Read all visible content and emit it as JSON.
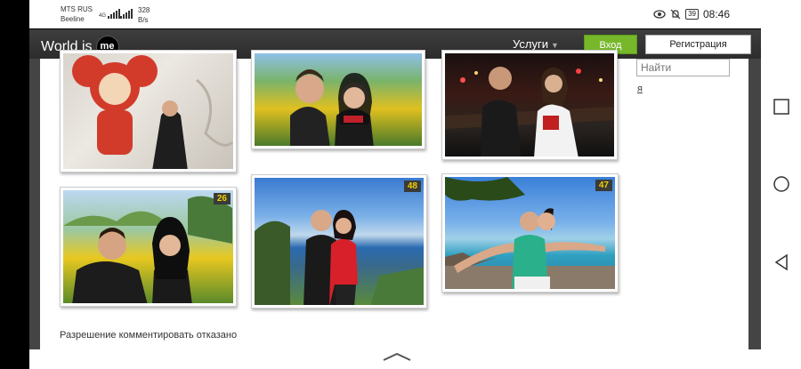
{
  "status_bar": {
    "carrier1": "MTS RUS",
    "carrier2": "Beeline",
    "net_type": "4G",
    "speed_value": "328",
    "speed_unit": "B/s",
    "battery": "39",
    "time": "08:46"
  },
  "header": {
    "logo_text": "World is",
    "logo_badge": "me",
    "services_label": "Услуги",
    "login_label": "Вход",
    "register_label": "Регистрация"
  },
  "sidebar": {
    "search_placeholder": "Найти",
    "link_text": "я"
  },
  "gallery": {
    "photos": [
      {
        "badge": ""
      },
      {
        "badge": ""
      },
      {
        "badge": ""
      },
      {
        "badge": "26"
      },
      {
        "badge": "48"
      },
      {
        "badge": "47"
      }
    ]
  },
  "comments": {
    "notice": "Разрешение комментировать отказано"
  },
  "colors": {
    "nav_bg": "#333333",
    "login_green": "#76b82a",
    "badge_text": "#f0d000"
  }
}
